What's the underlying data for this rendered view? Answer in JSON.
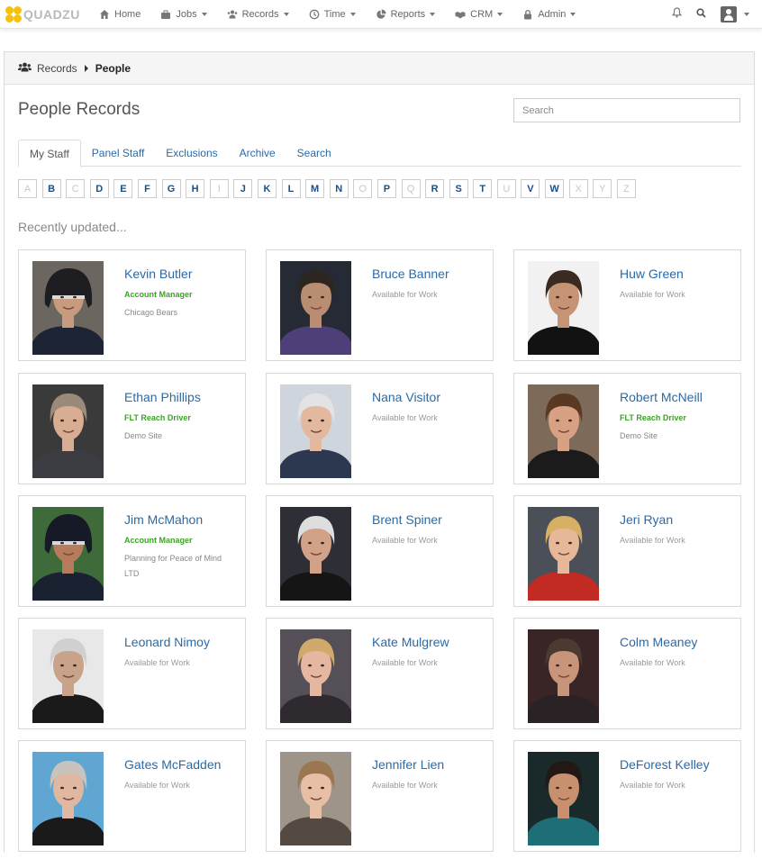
{
  "app": {
    "logo_text": "QUADZU"
  },
  "nav": {
    "items": [
      {
        "label": "Home",
        "icon": "home-icon",
        "dropdown": false
      },
      {
        "label": "Jobs",
        "icon": "briefcase-icon",
        "dropdown": true
      },
      {
        "label": "Records",
        "icon": "users-icon",
        "dropdown": true
      },
      {
        "label": "Time",
        "icon": "clock-icon",
        "dropdown": true
      },
      {
        "label": "Reports",
        "icon": "pie-chart-icon",
        "dropdown": true
      },
      {
        "label": "CRM",
        "icon": "handshake-icon",
        "dropdown": true
      },
      {
        "label": "Admin",
        "icon": "lock-icon",
        "dropdown": true
      }
    ]
  },
  "breadcrumb": {
    "parent": "Records",
    "current": "People"
  },
  "page": {
    "title": "People Records",
    "search_placeholder": "Search",
    "recent_heading": "Recently updated..."
  },
  "tabs": [
    {
      "label": "My Staff",
      "active": true
    },
    {
      "label": "Panel Staff",
      "active": false
    },
    {
      "label": "Exclusions",
      "active": false
    },
    {
      "label": "Archive",
      "active": false
    },
    {
      "label": "Search",
      "active": false
    }
  ],
  "alphabet": [
    {
      "letter": "A",
      "enabled": false
    },
    {
      "letter": "B",
      "enabled": true
    },
    {
      "letter": "C",
      "enabled": false
    },
    {
      "letter": "D",
      "enabled": true
    },
    {
      "letter": "E",
      "enabled": true
    },
    {
      "letter": "F",
      "enabled": true
    },
    {
      "letter": "G",
      "enabled": true
    },
    {
      "letter": "H",
      "enabled": true
    },
    {
      "letter": "I",
      "enabled": false
    },
    {
      "letter": "J",
      "enabled": true
    },
    {
      "letter": "K",
      "enabled": true
    },
    {
      "letter": "L",
      "enabled": true
    },
    {
      "letter": "M",
      "enabled": true
    },
    {
      "letter": "N",
      "enabled": true
    },
    {
      "letter": "O",
      "enabled": false
    },
    {
      "letter": "P",
      "enabled": true
    },
    {
      "letter": "Q",
      "enabled": false
    },
    {
      "letter": "R",
      "enabled": true
    },
    {
      "letter": "S",
      "enabled": true
    },
    {
      "letter": "T",
      "enabled": true
    },
    {
      "letter": "U",
      "enabled": false
    },
    {
      "letter": "V",
      "enabled": true
    },
    {
      "letter": "W",
      "enabled": true
    },
    {
      "letter": "X",
      "enabled": false
    },
    {
      "letter": "Y",
      "enabled": false
    },
    {
      "letter": "Z",
      "enabled": false
    }
  ],
  "people": [
    {
      "name": "Kevin Butler",
      "role": "Account Manager",
      "org": "Chicago Bears",
      "status": "",
      "photo": {
        "bg": "#6b6760",
        "skin": "#c79c7e",
        "hair": "#1e1e22",
        "shirt": "#1d2433",
        "helmet": true
      }
    },
    {
      "name": "Bruce Banner",
      "role": "",
      "org": "",
      "status": "Available for Work",
      "photo": {
        "bg": "#262a35",
        "skin": "#b98d72",
        "hair": "#2c2520",
        "shirt": "#4f3f78"
      }
    },
    {
      "name": "Huw Green",
      "role": "",
      "org": "",
      "status": "Available for Work",
      "photo": {
        "bg": "#f1f1f1",
        "skin": "#c69475",
        "hair": "#3a2a20",
        "shirt": "#121212"
      }
    },
    {
      "name": "Ethan Phillips",
      "role": "FLT Reach Driver",
      "org": "Demo Site",
      "status": "",
      "photo": {
        "bg": "#3a3a3a",
        "skin": "#d9ad92",
        "hair": "#9a8a7a",
        "shirt": "#3c3d42"
      }
    },
    {
      "name": "Nana Visitor",
      "role": "",
      "org": "",
      "status": "Available for Work",
      "photo": {
        "bg": "#cfd5dc",
        "skin": "#e2b99f",
        "hair": "#e3e3e3",
        "shirt": "#2c3850"
      }
    },
    {
      "name": "Robert McNeill",
      "role": "FLT Reach Driver",
      "org": "Demo Site",
      "status": "",
      "photo": {
        "bg": "#7e6a58",
        "skin": "#d8a183",
        "hair": "#5a3822",
        "shirt": "#1b1b1b"
      }
    },
    {
      "name": "Jim McMahon",
      "role": "Account Manager",
      "org": "Planning for Peace of Mind LTD",
      "status": "",
      "photo": {
        "bg": "#3f6b3a",
        "skin": "#b67a5c",
        "hair": "#151a26",
        "shirt": "#1a2130",
        "helmet": true
      }
    },
    {
      "name": "Brent Spiner",
      "role": "",
      "org": "",
      "status": "Available for Work",
      "photo": {
        "bg": "#2e2e36",
        "skin": "#d2a288",
        "hair": "#dedede",
        "shirt": "#151515"
      }
    },
    {
      "name": "Jeri Ryan",
      "role": "",
      "org": "",
      "status": "Available for Work",
      "photo": {
        "bg": "#4a4f58",
        "skin": "#e6b898",
        "hair": "#d7b063",
        "shirt": "#c22a24"
      }
    },
    {
      "name": "Leonard Nimoy",
      "role": "",
      "org": "",
      "status": "Available for Work",
      "photo": {
        "bg": "#e8e8e8",
        "skin": "#c9a28a",
        "hair": "#d0d0d0",
        "shirt": "#1a1a1a"
      }
    },
    {
      "name": "Kate Mulgrew",
      "role": "",
      "org": "",
      "status": "Available for Work",
      "photo": {
        "bg": "#555057",
        "skin": "#e6b7a0",
        "hair": "#d1a96a",
        "shirt": "#2e2a30"
      }
    },
    {
      "name": "Colm Meaney",
      "role": "",
      "org": "",
      "status": "Available for Work",
      "photo": {
        "bg": "#3a2526",
        "skin": "#c9957a",
        "hair": "#4a3a30",
        "shirt": "#2a2224"
      }
    },
    {
      "name": "Gates McFadden",
      "role": "",
      "org": "",
      "status": "Available for Work",
      "photo": {
        "bg": "#5fa6d3",
        "skin": "#e0b8a2",
        "hair": "#c9c3bd",
        "shirt": "#1a1a1a"
      }
    },
    {
      "name": "Jennifer Lien",
      "role": "",
      "org": "",
      "status": "Available for Work",
      "photo": {
        "bg": "#9e948a",
        "skin": "#e6bfa5",
        "hair": "#9c7650",
        "shirt": "#544a42"
      }
    },
    {
      "name": "DeForest Kelley",
      "role": "",
      "org": "",
      "status": "Available for Work",
      "photo": {
        "bg": "#1a2a2a",
        "skin": "#c9906e",
        "hair": "#231815",
        "shirt": "#1e6e78"
      }
    }
  ]
}
